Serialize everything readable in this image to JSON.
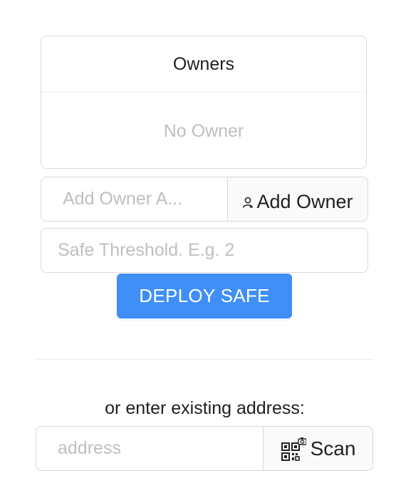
{
  "owners_panel": {
    "header": "Owners",
    "empty_text": "No Owner"
  },
  "add_owner": {
    "placeholder": "Add Owner A...",
    "button_label": "Add Owner",
    "button_icon": "user-add-icon"
  },
  "threshold": {
    "placeholder": "Safe Threshold. E.g. 2"
  },
  "deploy": {
    "label": "DEPLOY SAFE",
    "color": "#3f8ff7"
  },
  "existing": {
    "label": "or enter existing address:",
    "placeholder": "address",
    "scan_label": "Scan",
    "scan_icon": "qr-scan-icon"
  }
}
